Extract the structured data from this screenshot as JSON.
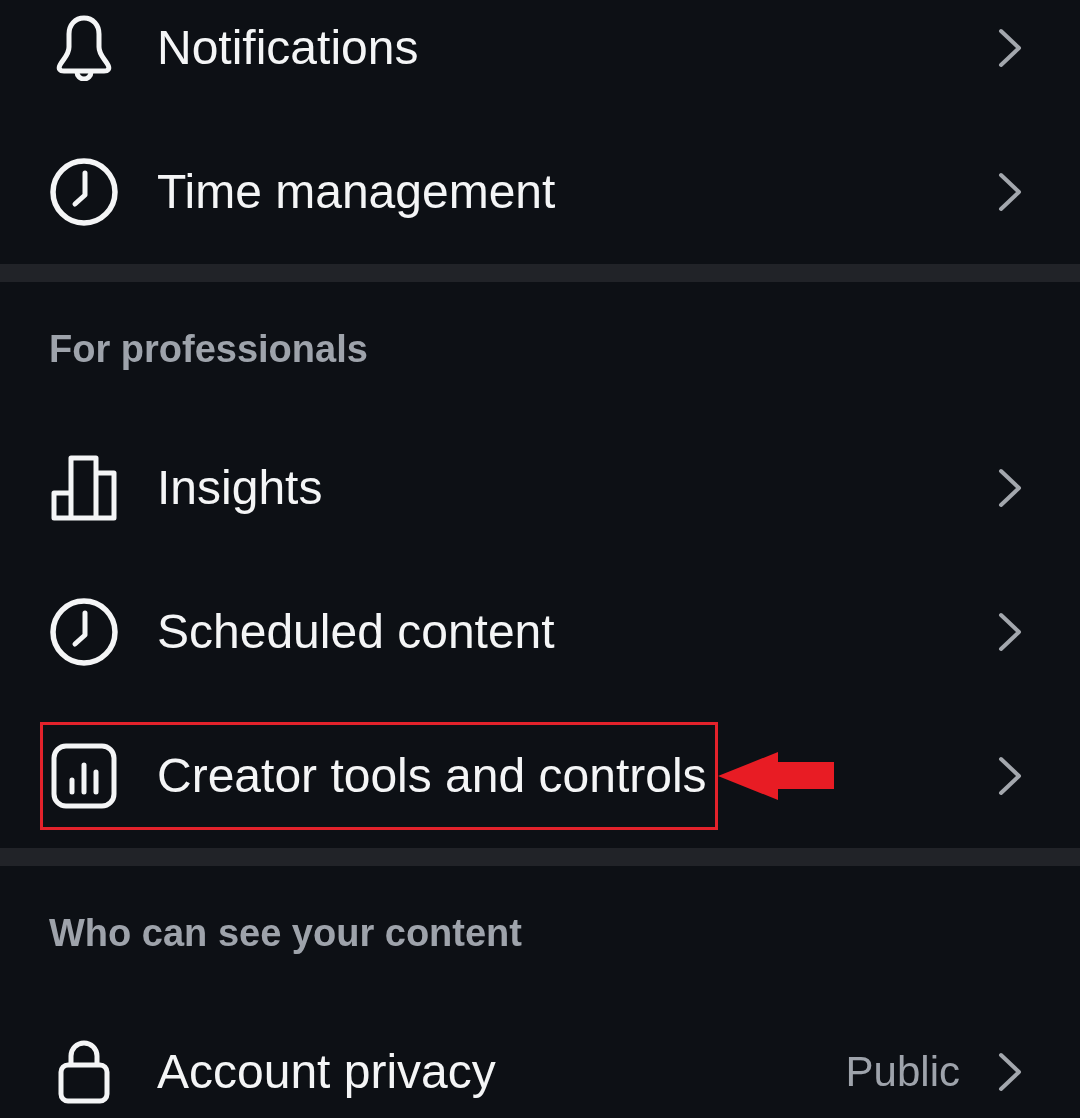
{
  "sections": [
    {
      "items": [
        {
          "label": "Notifications",
          "highlighted": false
        },
        {
          "label": "Time management",
          "highlighted": false
        }
      ]
    },
    {
      "title": "For professionals",
      "items": [
        {
          "label": "Insights",
          "highlighted": false
        },
        {
          "label": "Scheduled content",
          "highlighted": false
        },
        {
          "label": "Creator tools and controls",
          "highlighted": true
        }
      ]
    },
    {
      "title": "Who can see your content",
      "items": [
        {
          "label": "Account privacy",
          "value": "Public",
          "highlighted": false
        }
      ]
    }
  ]
}
